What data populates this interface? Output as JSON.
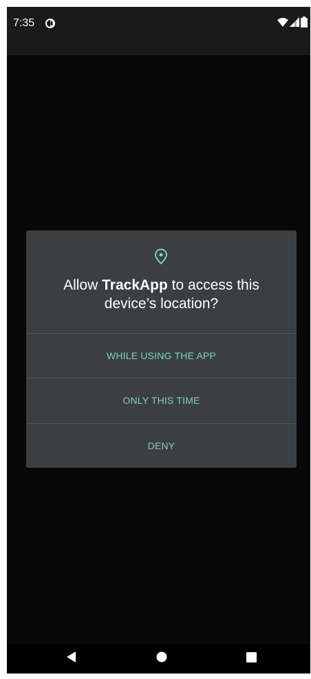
{
  "status_bar": {
    "time": "7:35",
    "icons": [
      "app-notification-icon",
      "wifi-icon",
      "signal-icon",
      "battery-icon"
    ]
  },
  "dialog": {
    "icon": "location-pin-icon",
    "title_prefix": "Allow ",
    "app_name": "TrackApp",
    "title_suffix": " to access this device’s location?",
    "options": [
      {
        "label": "WHILE USING THE APP"
      },
      {
        "label": "ONLY THIS TIME"
      },
      {
        "label": "DENY"
      }
    ],
    "accent_color": "#7fcfc5"
  },
  "nav_bar": {
    "buttons": [
      "back-icon",
      "home-icon",
      "recents-icon"
    ]
  }
}
